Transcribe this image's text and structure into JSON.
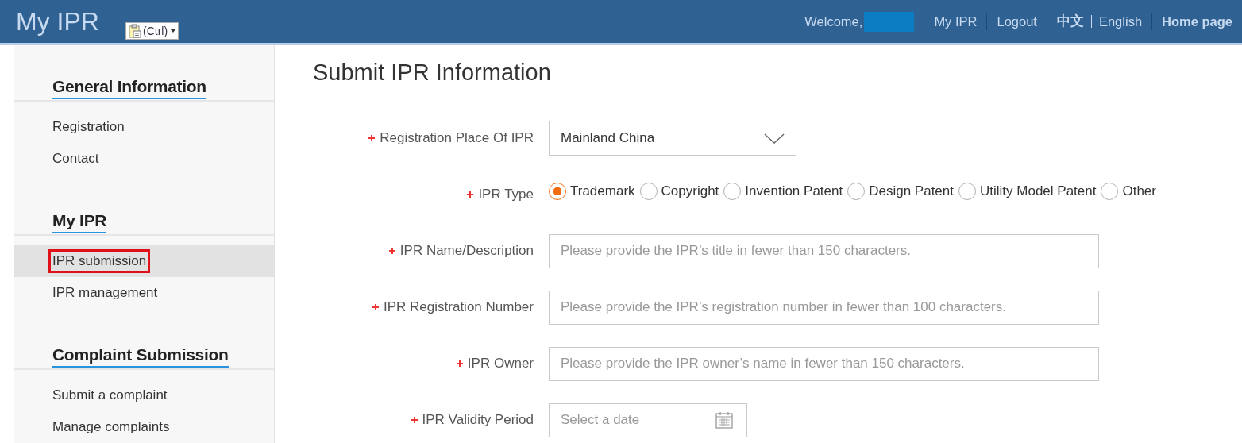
{
  "header": {
    "title": "My IPR",
    "paste_popup": {
      "label": "(Ctrl)"
    },
    "welcome": "Welcome,",
    "links": [
      {
        "label": "My IPR",
        "bold": false
      },
      {
        "label": "Logout",
        "bold": false
      }
    ],
    "languages": [
      {
        "label": "中文",
        "selected": true
      },
      {
        "label": "English",
        "selected": false
      }
    ],
    "home": "Home page"
  },
  "sidebar": {
    "sections": [
      {
        "title": "General Information",
        "items": [
          {
            "label": "Registration",
            "selected": false,
            "annotated": false
          },
          {
            "label": "Contact",
            "selected": false,
            "annotated": false
          }
        ]
      },
      {
        "title": "My IPR",
        "items": [
          {
            "label": "IPR submission",
            "selected": true,
            "annotated": true
          },
          {
            "label": "IPR management",
            "selected": false,
            "annotated": false
          }
        ]
      },
      {
        "title": "Complaint Submission",
        "items": [
          {
            "label": "Submit a complaint",
            "selected": false,
            "annotated": false
          },
          {
            "label": "Manage complaints",
            "selected": false,
            "annotated": false
          }
        ]
      }
    ]
  },
  "page_title": "Submit IPR Information",
  "form": [
    {
      "kind": "select",
      "label": "Registration Place Of IPR",
      "required": true,
      "value": "Mainland China"
    },
    {
      "kind": "radio",
      "label": "IPR Type",
      "required": true,
      "options": [
        {
          "label": "Trademark",
          "selected": true
        },
        {
          "label": "Copyright",
          "selected": false
        },
        {
          "label": "Invention Patent",
          "selected": false
        },
        {
          "label": "Design Patent",
          "selected": false
        },
        {
          "label": "Utility Model Patent",
          "selected": false
        },
        {
          "label": "Other",
          "selected": false
        }
      ]
    },
    {
      "kind": "text",
      "label": "IPR Name/Description",
      "required": true,
      "placeholder": "Please provide the IPR’s title in fewer than 150 characters."
    },
    {
      "kind": "text",
      "label": "IPR Registration Number",
      "required": true,
      "placeholder": "Please provide the IPR’s registration number in fewer than 100 characters."
    },
    {
      "kind": "text",
      "label": "IPR Owner",
      "required": true,
      "placeholder": "Please provide the IPR owner’s name in fewer than 150 characters."
    },
    {
      "kind": "date",
      "label": "IPR Validity Period",
      "required": true,
      "placeholder": "Select a date"
    }
  ]
}
